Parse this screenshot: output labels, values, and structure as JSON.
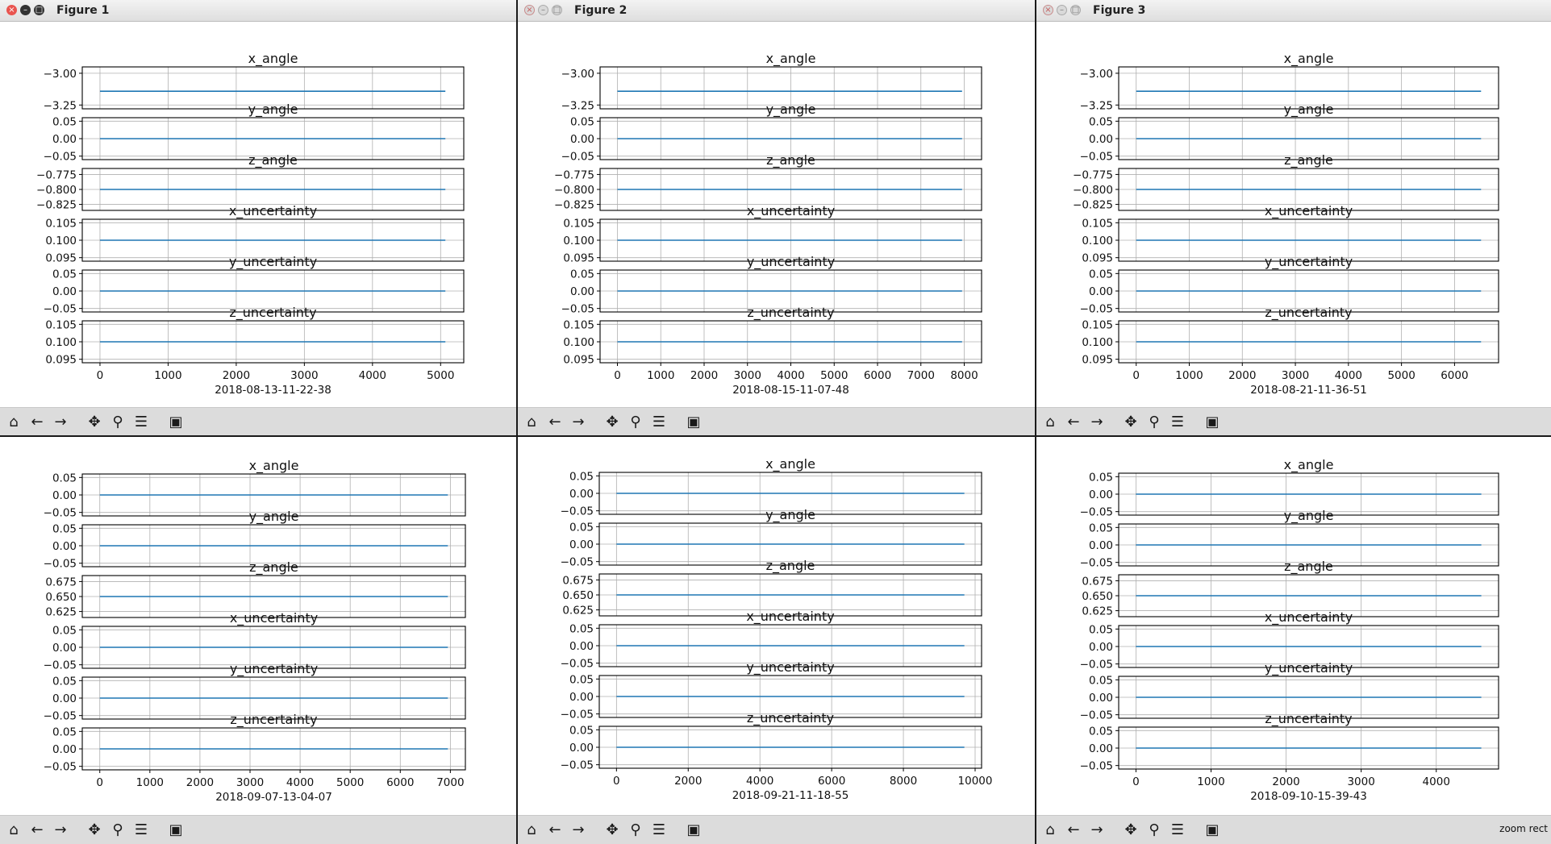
{
  "toolbar_icons": [
    "home-icon",
    "back-icon",
    "forward-icon",
    "pan-icon",
    "zoom-icon",
    "configure-subplots-icon",
    "save-icon"
  ],
  "colors": {
    "line": "#1f77b4",
    "grid": "#b0b0b0"
  },
  "windows": [
    {
      "title": "Figure 1",
      "active": true,
      "status": "",
      "chart_data": {
        "type": "line",
        "xlabel": "2018-08-13-11-22-38",
        "xlim": [
          -260,
          5340
        ],
        "xticks": [
          0,
          1000,
          2000,
          3000,
          4000,
          5000
        ],
        "x_range": [
          0,
          5070
        ],
        "subplots": [
          {
            "title": "x_angle",
            "ylim": [
              -3.28,
              -2.95
            ],
            "yticks": [
              -3.0,
              -3.25
            ],
            "ytick_labels": [
              "−3.00",
              "−3.25"
            ],
            "value": -3.1416
          },
          {
            "title": "y_angle",
            "ylim": [
              -0.06,
              0.06
            ],
            "yticks": [
              0.05,
              0.0,
              -0.05
            ],
            "ytick_labels": [
              "0.05",
              "0.00",
              "−0.05"
            ],
            "value": 0.0
          },
          {
            "title": "z_angle",
            "ylim": [
              -0.835,
              -0.765
            ],
            "yticks": [
              -0.775,
              -0.8,
              -0.825
            ],
            "ytick_labels": [
              "−0.775",
              "−0.800",
              "−0.825"
            ],
            "value": -0.8
          },
          {
            "title": "x_uncertainty",
            "ylim": [
              0.094,
              0.106
            ],
            "yticks": [
              0.105,
              0.1,
              0.095
            ],
            "ytick_labels": [
              "0.105",
              "0.100",
              "0.095"
            ],
            "value": 0.1
          },
          {
            "title": "y_uncertainty",
            "ylim": [
              -0.06,
              0.06
            ],
            "yticks": [
              0.05,
              0.0,
              -0.05
            ],
            "ytick_labels": [
              "0.05",
              "0.00",
              "−0.05"
            ],
            "value": 0.0
          },
          {
            "title": "z_uncertainty",
            "ylim": [
              0.094,
              0.106
            ],
            "yticks": [
              0.105,
              0.1,
              0.095
            ],
            "ytick_labels": [
              "0.105",
              "0.100",
              "0.095"
            ],
            "value": 0.1
          }
        ]
      }
    },
    {
      "title": "Figure 2",
      "active": false,
      "status": "",
      "chart_data": {
        "type": "line",
        "xlabel": "2018-08-15-11-07-48",
        "xlim": [
          -400,
          8400
        ],
        "xticks": [
          0,
          1000,
          2000,
          3000,
          4000,
          5000,
          6000,
          7000,
          8000
        ],
        "x_range": [
          0,
          7950
        ],
        "subplots": [
          {
            "title": "x_angle",
            "ylim": [
              -3.28,
              -2.95
            ],
            "yticks": [
              -3.0,
              -3.25
            ],
            "ytick_labels": [
              "−3.00",
              "−3.25"
            ],
            "value": -3.1416
          },
          {
            "title": "y_angle",
            "ylim": [
              -0.06,
              0.06
            ],
            "yticks": [
              0.05,
              0.0,
              -0.05
            ],
            "ytick_labels": [
              "0.05",
              "0.00",
              "−0.05"
            ],
            "value": 0.0
          },
          {
            "title": "z_angle",
            "ylim": [
              -0.835,
              -0.765
            ],
            "yticks": [
              -0.775,
              -0.8,
              -0.825
            ],
            "ytick_labels": [
              "−0.775",
              "−0.800",
              "−0.825"
            ],
            "value": -0.8
          },
          {
            "title": "x_uncertainty",
            "ylim": [
              0.094,
              0.106
            ],
            "yticks": [
              0.105,
              0.1,
              0.095
            ],
            "ytick_labels": [
              "0.105",
              "0.100",
              "0.095"
            ],
            "value": 0.1
          },
          {
            "title": "y_uncertainty",
            "ylim": [
              -0.06,
              0.06
            ],
            "yticks": [
              0.05,
              0.0,
              -0.05
            ],
            "ytick_labels": [
              "0.05",
              "0.00",
              "−0.05"
            ],
            "value": 0.0
          },
          {
            "title": "z_uncertainty",
            "ylim": [
              0.094,
              0.106
            ],
            "yticks": [
              0.105,
              0.1,
              0.095
            ],
            "ytick_labels": [
              "0.105",
              "0.100",
              "0.095"
            ],
            "value": 0.1
          }
        ]
      }
    },
    {
      "title": "Figure 3",
      "active": false,
      "status": "",
      "chart_data": {
        "type": "line",
        "xlabel": "2018-08-21-11-36-51",
        "xlim": [
          -330,
          6830
        ],
        "xticks": [
          0,
          1000,
          2000,
          3000,
          4000,
          5000,
          6000
        ],
        "x_range": [
          0,
          6500
        ],
        "subplots": [
          {
            "title": "x_angle",
            "ylim": [
              -3.28,
              -2.95
            ],
            "yticks": [
              -3.0,
              -3.25
            ],
            "ytick_labels": [
              "−3.00",
              "−3.25"
            ],
            "value": -3.1416
          },
          {
            "title": "y_angle",
            "ylim": [
              -0.06,
              0.06
            ],
            "yticks": [
              0.05,
              0.0,
              -0.05
            ],
            "ytick_labels": [
              "0.05",
              "0.00",
              "−0.05"
            ],
            "value": 0.0
          },
          {
            "title": "z_angle",
            "ylim": [
              -0.835,
              -0.765
            ],
            "yticks": [
              -0.775,
              -0.8,
              -0.825
            ],
            "ytick_labels": [
              "−0.775",
              "−0.800",
              "−0.825"
            ],
            "value": -0.8
          },
          {
            "title": "x_uncertainty",
            "ylim": [
              0.094,
              0.106
            ],
            "yticks": [
              0.105,
              0.1,
              0.095
            ],
            "ytick_labels": [
              "0.105",
              "0.100",
              "0.095"
            ],
            "value": 0.1
          },
          {
            "title": "y_uncertainty",
            "ylim": [
              -0.06,
              0.06
            ],
            "yticks": [
              0.05,
              0.0,
              -0.05
            ],
            "ytick_labels": [
              "0.05",
              "0.00",
              "−0.05"
            ],
            "value": 0.0
          },
          {
            "title": "z_uncertainty",
            "ylim": [
              0.094,
              0.106
            ],
            "yticks": [
              0.105,
              0.1,
              0.095
            ],
            "ytick_labels": [
              "0.105",
              "0.100",
              "0.095"
            ],
            "value": 0.1
          }
        ]
      }
    },
    {
      "title": "",
      "active": false,
      "status": "",
      "chart_data": {
        "type": "line",
        "xlabel": "2018-09-07-13-04-07",
        "xlim": [
          -350,
          7300
        ],
        "xticks": [
          0,
          1000,
          2000,
          3000,
          4000,
          5000,
          6000,
          7000
        ],
        "x_range": [
          0,
          6950
        ],
        "subplots": [
          {
            "title": "x_angle",
            "ylim": [
              -0.06,
              0.06
            ],
            "yticks": [
              0.05,
              0.0,
              -0.05
            ],
            "ytick_labels": [
              "0.05",
              "0.00",
              "−0.05"
            ],
            "value": 0.0
          },
          {
            "title": "y_angle",
            "ylim": [
              -0.06,
              0.06
            ],
            "yticks": [
              0.05,
              0.0,
              -0.05
            ],
            "ytick_labels": [
              "0.05",
              "0.00",
              "−0.05"
            ],
            "value": 0.0
          },
          {
            "title": "z_angle",
            "ylim": [
              0.615,
              0.685
            ],
            "yticks": [
              0.675,
              0.65,
              0.625
            ],
            "ytick_labels": [
              "0.675",
              "0.650",
              "0.625"
            ],
            "value": 0.65
          },
          {
            "title": "x_uncertainty",
            "ylim": [
              -0.06,
              0.06
            ],
            "yticks": [
              0.05,
              0.0,
              -0.05
            ],
            "ytick_labels": [
              "0.05",
              "0.00",
              "−0.05"
            ],
            "value": 0.0
          },
          {
            "title": "y_uncertainty",
            "ylim": [
              -0.06,
              0.06
            ],
            "yticks": [
              0.05,
              0.0,
              -0.05
            ],
            "ytick_labels": [
              "0.05",
              "0.00",
              "−0.05"
            ],
            "value": 0.0
          },
          {
            "title": "z_uncertainty",
            "ylim": [
              -0.06,
              0.06
            ],
            "yticks": [
              0.05,
              0.0,
              -0.05
            ],
            "ytick_labels": [
              "0.05",
              "0.00",
              "−0.05"
            ],
            "value": 0.0
          }
        ]
      }
    },
    {
      "title": "",
      "active": false,
      "status": "",
      "chart_data": {
        "type": "line",
        "xlabel": "2018-09-21-11-18-55",
        "xlim": [
          -480,
          10180
        ],
        "xticks": [
          0,
          2000,
          4000,
          6000,
          8000,
          10000
        ],
        "x_range": [
          0,
          9700
        ],
        "subplots": [
          {
            "title": "x_angle",
            "ylim": [
              -0.06,
              0.06
            ],
            "yticks": [
              0.05,
              0.0,
              -0.05
            ],
            "ytick_labels": [
              "0.05",
              "0.00",
              "−0.05"
            ],
            "value": 0.0
          },
          {
            "title": "y_angle",
            "ylim": [
              -0.06,
              0.06
            ],
            "yticks": [
              0.05,
              0.0,
              -0.05
            ],
            "ytick_labels": [
              "0.05",
              "0.00",
              "−0.05"
            ],
            "value": 0.0
          },
          {
            "title": "z_angle",
            "ylim": [
              0.615,
              0.685
            ],
            "yticks": [
              0.675,
              0.65,
              0.625
            ],
            "ytick_labels": [
              "0.675",
              "0.650",
              "0.625"
            ],
            "value": 0.65
          },
          {
            "title": "x_uncertainty",
            "ylim": [
              -0.06,
              0.06
            ],
            "yticks": [
              0.05,
              0.0,
              -0.05
            ],
            "ytick_labels": [
              "0.05",
              "0.00",
              "−0.05"
            ],
            "value": 0.0
          },
          {
            "title": "y_uncertainty",
            "ylim": [
              -0.06,
              0.06
            ],
            "yticks": [
              0.05,
              0.0,
              -0.05
            ],
            "ytick_labels": [
              "0.05",
              "0.00",
              "−0.05"
            ],
            "value": 0.0
          },
          {
            "title": "z_uncertainty",
            "ylim": [
              -0.06,
              0.06
            ],
            "yticks": [
              0.05,
              0.0,
              -0.05
            ],
            "ytick_labels": [
              "0.05",
              "0.00",
              "−0.05"
            ],
            "value": 0.0
          }
        ]
      }
    },
    {
      "title": "",
      "active": false,
      "status": "zoom rect",
      "chart_data": {
        "type": "line",
        "xlabel": "2018-09-10-15-39-43",
        "xlim": [
          -230,
          4830
        ],
        "xticks": [
          0,
          1000,
          2000,
          3000,
          4000
        ],
        "x_range": [
          0,
          4600
        ],
        "subplots": [
          {
            "title": "x_angle",
            "ylim": [
              -0.06,
              0.06
            ],
            "yticks": [
              0.05,
              0.0,
              -0.05
            ],
            "ytick_labels": [
              "0.05",
              "0.00",
              "−0.05"
            ],
            "value": 0.0
          },
          {
            "title": "y_angle",
            "ylim": [
              -0.06,
              0.06
            ],
            "yticks": [
              0.05,
              0.0,
              -0.05
            ],
            "ytick_labels": [
              "0.05",
              "0.00",
              "−0.05"
            ],
            "value": 0.0
          },
          {
            "title": "z_angle",
            "ylim": [
              0.615,
              0.685
            ],
            "yticks": [
              0.675,
              0.65,
              0.625
            ],
            "ytick_labels": [
              "0.675",
              "0.650",
              "0.625"
            ],
            "value": 0.65
          },
          {
            "title": "x_uncertainty",
            "ylim": [
              -0.06,
              0.06
            ],
            "yticks": [
              0.05,
              0.0,
              -0.05
            ],
            "ytick_labels": [
              "0.05",
              "0.00",
              "−0.05"
            ],
            "value": 0.0
          },
          {
            "title": "y_uncertainty",
            "ylim": [
              -0.06,
              0.06
            ],
            "yticks": [
              0.05,
              0.0,
              -0.05
            ],
            "ytick_labels": [
              "0.05",
              "0.00",
              "−0.05"
            ],
            "value": 0.0
          },
          {
            "title": "z_uncertainty",
            "ylim": [
              -0.06,
              0.06
            ],
            "yticks": [
              0.05,
              0.0,
              -0.05
            ],
            "ytick_labels": [
              "0.05",
              "0.00",
              "−0.05"
            ],
            "value": 0.0
          }
        ]
      }
    }
  ]
}
